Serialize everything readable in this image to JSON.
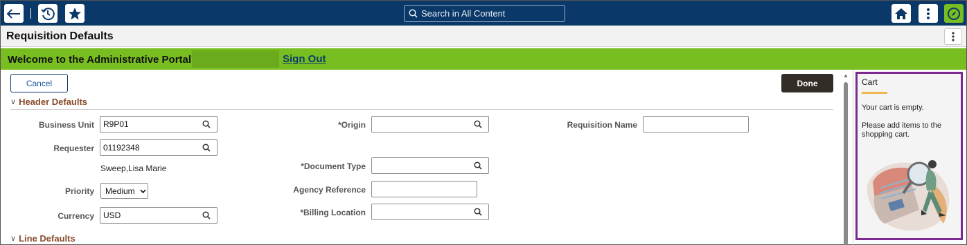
{
  "topbar": {
    "back_icon": "arrow-left-icon",
    "recent_icon": "history-icon",
    "favorites_icon": "star-icon",
    "search_placeholder": "Search in All Content",
    "home_icon": "home-icon",
    "actions_icon": "vertical-dots-icon",
    "navbar_icon": "compass-icon",
    "colors": {
      "bar": "#0a3868",
      "navbar_button": "#78be20"
    }
  },
  "page": {
    "title": "Requisition Defaults"
  },
  "banner": {
    "welcome": "Welcome to the Administrative Portal,",
    "sign_out": "Sign Out",
    "color": "#78be20"
  },
  "actions": {
    "cancel": "Cancel",
    "done": "Done"
  },
  "header_defaults": {
    "title": "Header Defaults",
    "business_unit": {
      "label": "Business Unit",
      "value": "R9P01"
    },
    "requester": {
      "label": "Requester",
      "value": "01192348",
      "name": "Sweep,Lisa Marie"
    },
    "priority": {
      "label": "Priority",
      "value": "Medium"
    },
    "currency": {
      "label": "Currency",
      "value": "USD"
    },
    "origin": {
      "label": "*Origin",
      "value": ""
    },
    "document_type": {
      "label": "*Document Type",
      "value": ""
    },
    "agency_reference": {
      "label": "Agency Reference",
      "value": ""
    },
    "billing_location": {
      "label": "*Billing Location",
      "value": ""
    },
    "requisition_name": {
      "label": "Requisition Name",
      "value": ""
    }
  },
  "line_defaults": {
    "title": "Line Defaults"
  },
  "cart": {
    "title": "Cart",
    "empty": "Your cart is empty.",
    "message": "Please add items to the shopping cart.",
    "accent": "#7b2a90"
  }
}
